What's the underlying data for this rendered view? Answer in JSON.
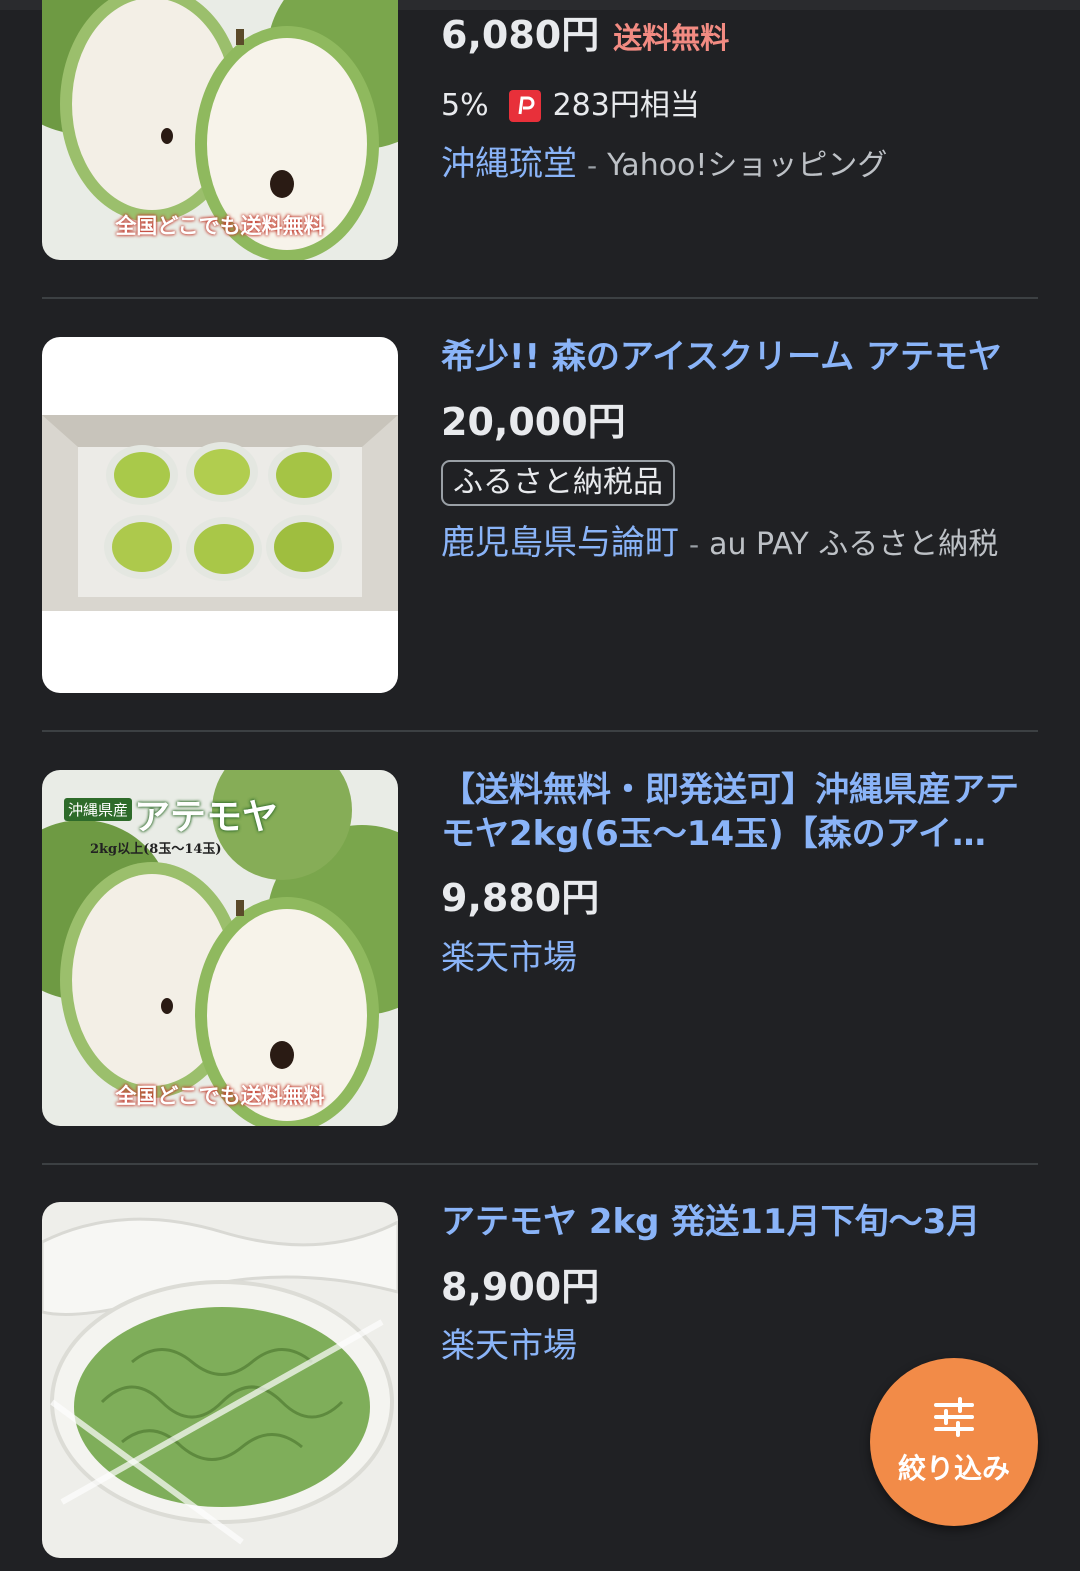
{
  "results": [
    {
      "price": "6,080円",
      "shipping": "送料無料",
      "points_rate": "5%",
      "points_value": "283円相当",
      "shop": "沖縄琉堂",
      "separator": "-",
      "source": "Yahoo!ショッピング",
      "image_caption": "全国どこでも送料無料",
      "image_icon": "cherimoya-cut-image"
    },
    {
      "title": "希少!! 森のアイスクリーム アテモヤ",
      "price": "20,000円",
      "badge": "ふるさと納税品",
      "shop": "鹿児島県与論町",
      "separator": "-",
      "source": "au PAY ふるさと納税",
      "image_icon": "atemoya-box-image"
    },
    {
      "title": "【送料無料・即発送可】沖縄県産アテモヤ2kg(6玉〜14玉)【森のアイ…",
      "price": "9,880円",
      "shop": "楽天市場",
      "image_label_top": "沖縄県産",
      "image_label_big": "アテモヤ",
      "image_label_weight": "2kg以上(8玉〜14玉)",
      "image_caption": "全国どこでも送料無料",
      "image_icon": "cherimoya-cut-image"
    },
    {
      "title": "アテモヤ 2kg 発送11月下旬〜3月",
      "price": "8,900円",
      "shop": "楽天市場",
      "image_icon": "atemoya-net-image"
    }
  ],
  "fab": {
    "label": "絞り込み",
    "icon": "filter-sliders-icon",
    "color": "#f28b48"
  },
  "colors": {
    "background": "#202124",
    "link": "#8ab4f8",
    "shipping": "#f28b82"
  }
}
